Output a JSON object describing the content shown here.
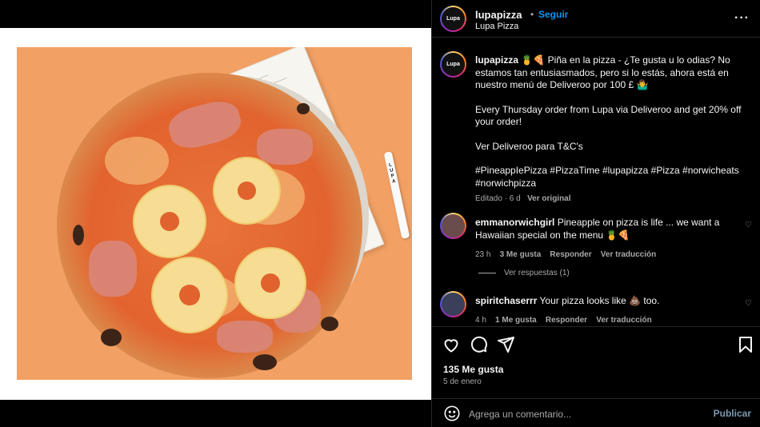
{
  "header": {
    "username": "lupapizza",
    "separator": "•",
    "follow_label": "Seguir",
    "subtitle": "Lupa Pizza",
    "more_icon": "more-horizontal-icon",
    "avatar_text": "Lupa"
  },
  "caption": {
    "username": "lupapizza",
    "line1": "🍍🍕 Piña en la pizza - ¿Te gusta u lo odias? No estamos tan entusiasmados, pero si lo estás, ahora está en nuestro menú de Deliveroo por 100 £ 🤷‍♂️",
    "line2": "Every Thursday order from Lupa via Deliveroo and get 20% off your order!",
    "line3": "Ver Deliveroo para T&C's",
    "hashtags": "#PineappIePizza #PizzaTime #lupapizza #Pizza #norwicheats #norwichpizza",
    "edited": "Editado · 6 d",
    "see_original": "Ver original"
  },
  "comments": [
    {
      "username": "emmanorwichgirl",
      "text": "Pineapple on pizza is life ... we want a Hawaiian special on the menu 🍍🍕",
      "time": "23 h",
      "likes": "3 Me gusta",
      "reply": "Responder",
      "translate": "Ver traducción"
    },
    {
      "username": "spiritchaserrr",
      "text": "Your pizza looks like 💩 too.",
      "time": "4 h",
      "likes": "1 Me gusta",
      "reply": "Responder",
      "translate": "Ver traducción"
    }
  ],
  "view_replies": "Ver respuestas (1)",
  "actions": {
    "like_icon": "heart-icon",
    "comment_icon": "comment-icon",
    "share_icon": "send-icon",
    "save_icon": "bookmark-icon",
    "likes_count": "135 Me gusta",
    "date": "5 de enero"
  },
  "composer": {
    "placeholder": "Agrega un comentario...",
    "publish_label": "Publicar",
    "emoji_icon": "emoji-icon"
  },
  "colors": {
    "accent": "#0095f6",
    "background": "#000000",
    "photo_bg": "#f2a064"
  }
}
